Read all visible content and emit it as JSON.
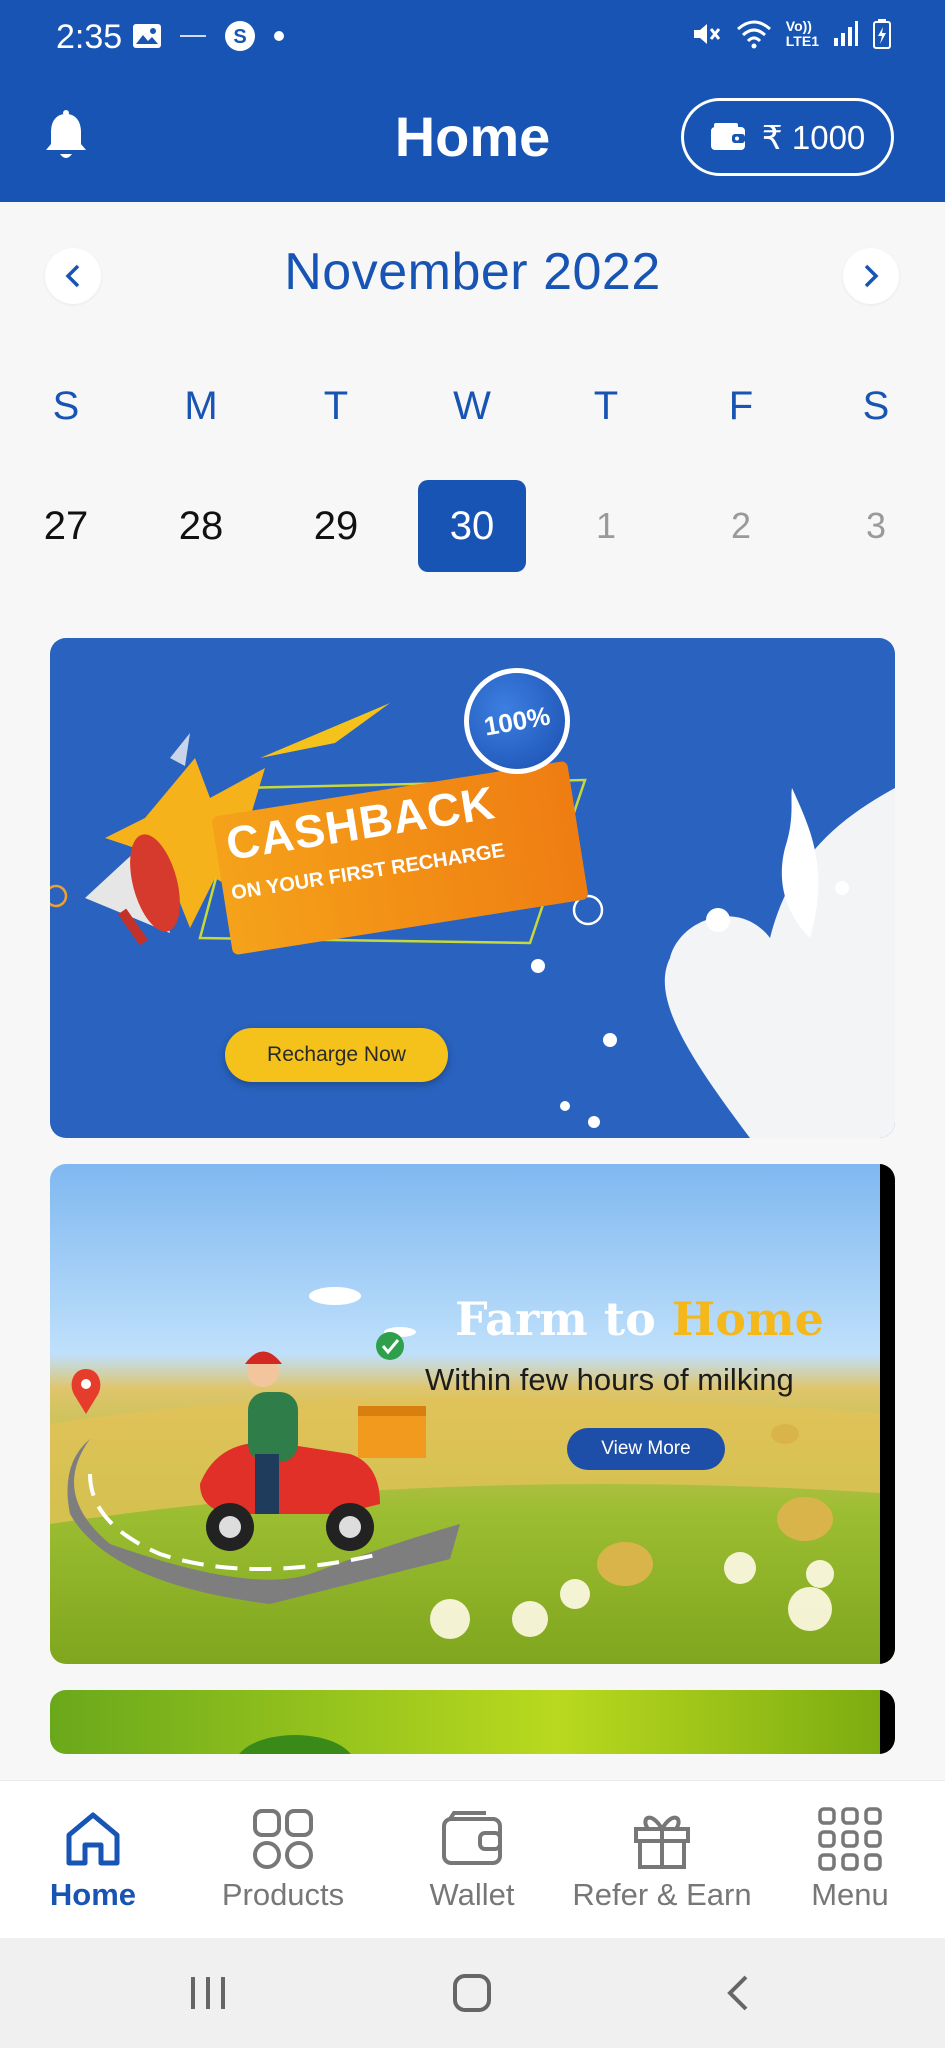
{
  "status_bar": {
    "time": "2:35",
    "left_icons": [
      "gallery-icon",
      "small-text-icon",
      "skype-icon",
      "dot-icon"
    ],
    "right_icons": [
      "mute-icon",
      "wifi-icon",
      "volte-lte-icon",
      "signal-icon",
      "battery-icon"
    ],
    "volte_label": "Vo))",
    "lte_label": "LTE1"
  },
  "header": {
    "title": "Home",
    "wallet_balance": "₹ 1000"
  },
  "calendar": {
    "month_title": "November 2022",
    "weekdays": [
      "S",
      "M",
      "T",
      "W",
      "T",
      "F",
      "S"
    ],
    "days": [
      "27",
      "28",
      "29",
      "30",
      "1",
      "2",
      "3"
    ],
    "selected_day": "30"
  },
  "banners": {
    "cashback": {
      "badge": "100%",
      "headline": "CASHBACK",
      "subline": "ON YOUR FIRST RECHARGE",
      "button": "Recharge Now"
    },
    "farm": {
      "title_part1": "Farm to ",
      "title_part2": "Home",
      "subtitle": "Within few hours of milking",
      "button": "View More"
    }
  },
  "bottom_nav": {
    "items": [
      {
        "label": "Home",
        "icon": "home-icon",
        "active": true
      },
      {
        "label": "Products",
        "icon": "grid-icon",
        "active": false
      },
      {
        "label": "Wallet",
        "icon": "wallet-icon",
        "active": false
      },
      {
        "label": "Refer & Earn",
        "icon": "gift-icon",
        "active": false
      },
      {
        "label": "Menu",
        "icon": "menu-dots-icon",
        "active": false
      }
    ]
  },
  "colors": {
    "brand_blue": "#1754b4",
    "banner_blue": "#2962bf",
    "accent_yellow": "#f5c21b",
    "inactive_grey": "#777777"
  }
}
